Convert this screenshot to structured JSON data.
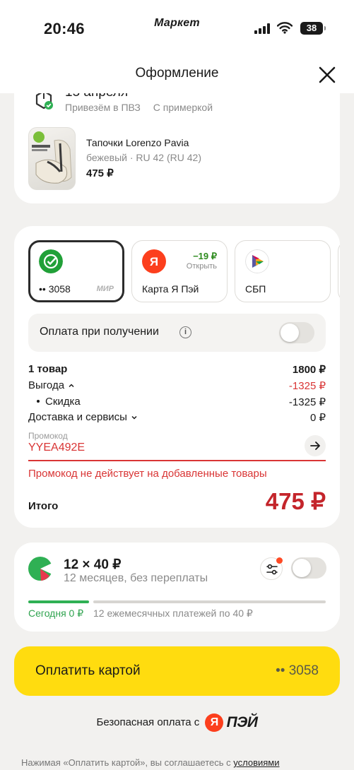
{
  "status_bar": {
    "time": "20:46",
    "brand": "Маркет",
    "battery": "38"
  },
  "header": {
    "title": "Оформление"
  },
  "delivery": {
    "date": "15 апреля",
    "option1": "Привезём в ПВЗ",
    "option2": "С примеркой",
    "product": {
      "name": "Тапочки Lorenzo Pavia",
      "attrs": "бежевый · RU 42 (RU 42)",
      "price": "475 ₽"
    }
  },
  "payment": {
    "methods": [
      {
        "label": "•• 3058",
        "badge": "МИР",
        "selected": true
      },
      {
        "label": "Карта Я Пэй",
        "promo": "−19 ₽",
        "promo_action": "Открыть"
      },
      {
        "label": "СБП"
      }
    ],
    "cod_label": "Оплата при получении",
    "summary": {
      "items_label": "1 товар",
      "items_value": "1800 ₽",
      "benefit_label": "Выгода",
      "benefit_value": "-1325 ₽",
      "discount_label": "Скидка",
      "discount_value": "-1325 ₽",
      "delivery_label": "Доставка и сервисы",
      "delivery_value": "0 ₽"
    },
    "promo": {
      "label": "Промокод",
      "code": "YYEA492E",
      "error": "Промокод не действует на добавленные товары"
    },
    "total_label": "Итого",
    "total_value": "475 ₽"
  },
  "split": {
    "amount": "12 × 40 ₽",
    "subtitle": "12 месяцев, без переплаты",
    "today": "Сегодня 0 ₽",
    "monthly": "12 ежемесячных платежей по 40 ₽"
  },
  "pay_button": {
    "label": "Оплатить картой",
    "card": "•• 3058"
  },
  "secure": {
    "text": "Безопасная оплата с",
    "logo_letter": "Я",
    "logo_word": "ПЭЙ"
  },
  "legal": {
    "text": "Нажимая «Оплатить картой», вы соглашаетесь с",
    "link": "условиями"
  },
  "colors": {
    "accent_yellow": "#ffdc0f",
    "error_red": "#d93535",
    "total_red": "#c4252b",
    "split_green": "#2fb054"
  }
}
